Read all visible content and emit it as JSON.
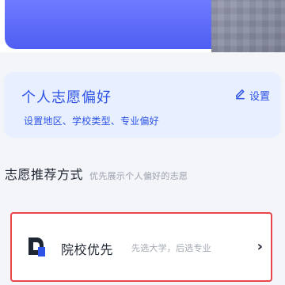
{
  "preferences": {
    "title": "个人志愿偏好",
    "subtitle": "设置地区、学校类型、专业偏好",
    "settings_label": "设置"
  },
  "section": {
    "title": "志愿推荐方式",
    "hint": "优先展示个人偏好的志愿"
  },
  "option": {
    "title": "院校优先",
    "description": "先选大学，后选专业",
    "chevron": "›"
  },
  "icons": {
    "settings": "pencil-icon",
    "option": "school-icon"
  },
  "colors": {
    "accent": "#2c53e6",
    "card_bg": "#e8efff",
    "highlight_border": "#e8464a"
  }
}
